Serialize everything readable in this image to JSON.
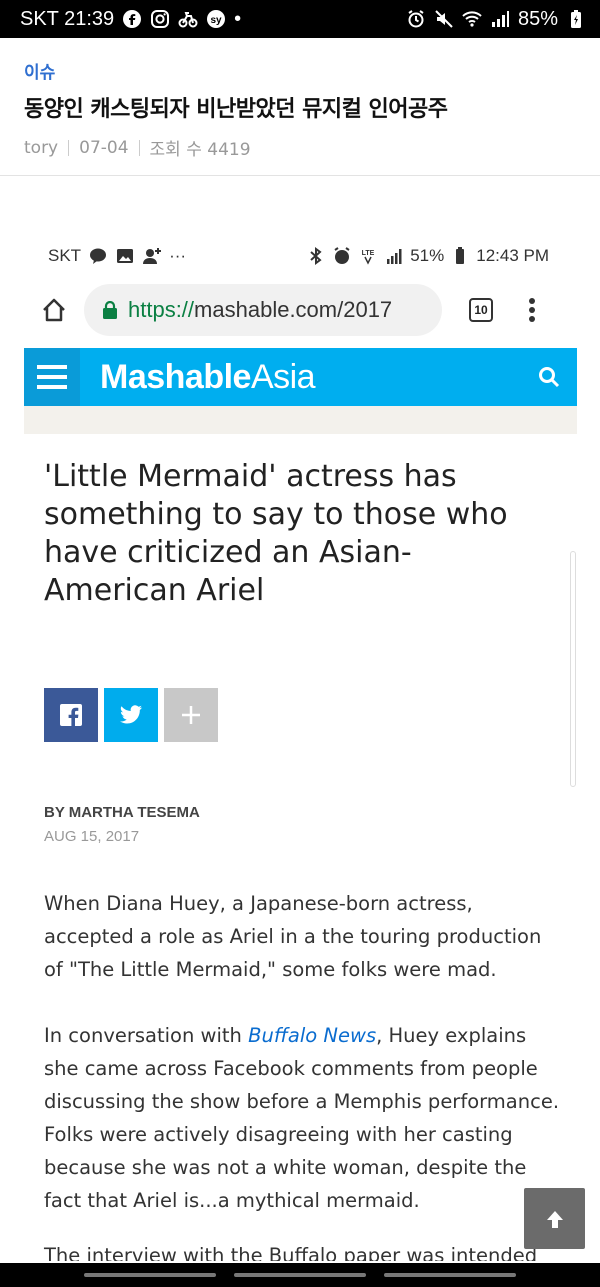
{
  "status_bar": {
    "carrier_time": "SKT 21:39",
    "dot": "•",
    "battery": "85%",
    "left_icons": [
      "facebook-icon",
      "instagram-icon",
      "bike-delivery-icon",
      "sy-app-icon"
    ],
    "right_icons": [
      "alarm-icon",
      "mute-icon",
      "wifi-icon",
      "signal-icon",
      "battery-charging-icon"
    ]
  },
  "post": {
    "category": "이슈",
    "title": "동양인 캐스팅되자 비난받았던 뮤지컬 인어공주",
    "author": "tory",
    "date": "07-04",
    "views": "조회 수 4419"
  },
  "screenshot": {
    "status": {
      "carrier": "SKT",
      "more": "···",
      "battery": "51%",
      "time": "12:43 PM"
    },
    "browser": {
      "url_scheme": "https://",
      "url_rest": "mashable.com/2017",
      "tab_count": "10"
    },
    "site": {
      "logo_bold": "Mashable",
      "logo_light": "Asia",
      "accent_color": "#00aeef"
    },
    "article": {
      "headline": "'Little Mermaid' actress has something to say to those who have criticized an Asian-American Ariel",
      "share_more": "+",
      "byline": "BY MARTHA TESEMA",
      "date": "AUG 15, 2017",
      "para1": "When Diana Huey, a Japanese-born actress, accepted a role as Ariel in a the touring production of \"The Little Mermaid,\" some folks were mad.",
      "para2_prefix": "In conversation with ",
      "para2_link": "Buffalo News",
      "para2_rest": ", Huey explains she came across Facebook comments from people discussing the show before a Memphis performance. Folks were actively disagreeing with her casting because she was not a white woman, despite the fact that Ariel is...a mythical mermaid.",
      "para3": "The interview with the Buffalo paper was intended"
    }
  },
  "back_to_top_icon": "arrow-up-icon"
}
